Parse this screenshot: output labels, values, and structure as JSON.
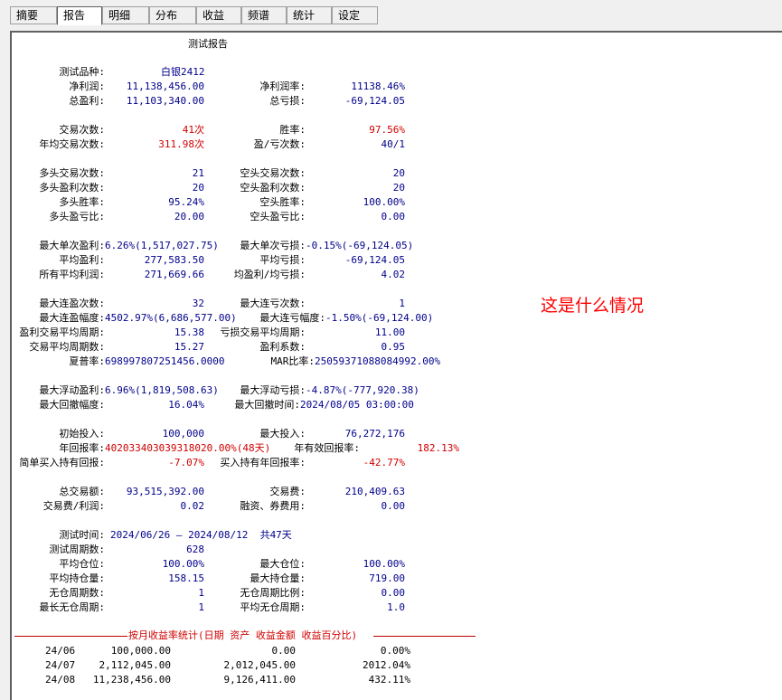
{
  "tabs": [
    {
      "label": "摘要"
    },
    {
      "label": "报告"
    },
    {
      "label": "明细"
    },
    {
      "label": "分布"
    },
    {
      "label": "收益"
    },
    {
      "label": "频谱"
    },
    {
      "label": "统计"
    },
    {
      "label": "设定"
    }
  ],
  "report": {
    "title": "测试报告",
    "product_label": "测试品种:",
    "product": "白银2412",
    "net_profit_label": "净利润:",
    "net_profit": "11,138,456.00",
    "net_profit_rate_label": "净利润率:",
    "net_profit_rate": "11138.46%",
    "gross_profit_label": "总盈利:",
    "gross_profit": "11,103,340.00",
    "gross_loss_label": "总亏损:",
    "gross_loss": "-69,124.05",
    "trades_label": "交易次数:",
    "trades": "41次",
    "win_rate_label": "胜率:",
    "win_rate": "97.56%",
    "annual_trades_label": "年均交易次数:",
    "annual_trades": "311.98次",
    "win_loss_count_label": "盈/亏次数:",
    "win_loss_count": "40/1",
    "long_trades_label": "多头交易次数:",
    "long_trades": "21",
    "short_trades_label": "空头交易次数:",
    "short_trades": "20",
    "long_wins_label": "多头盈利次数:",
    "long_wins": "20",
    "short_wins_label": "空头盈利次数:",
    "short_wins": "20",
    "long_win_rate_label": "多头胜率:",
    "long_win_rate": "95.24%",
    "short_win_rate_label": "空头胜率:",
    "short_win_rate": "100.00%",
    "long_pl_ratio_label": "多头盈亏比:",
    "long_pl_ratio": "20.00",
    "short_pl_ratio_label": "空头盈亏比:",
    "short_pl_ratio": "0.00",
    "max_single_win_label": "最大单次盈利:",
    "max_single_win": "6.26%(1,517,027.75)",
    "max_single_loss_label": "最大单次亏损:",
    "max_single_loss": "-0.15%(-69,124.05)",
    "avg_win_label": "平均盈利:",
    "avg_win": "277,583.50",
    "avg_loss_label": "平均亏损:",
    "avg_loss": "-69,124.05",
    "avg_profit_all_label": "所有平均利润:",
    "avg_profit_all": "271,669.66",
    "avg_win_loss_ratio_label": "均盈利/均亏损:",
    "avg_win_loss_ratio": "4.02",
    "max_consec_wins_label": "最大连盈次数:",
    "max_consec_wins": "32",
    "max_consec_losses_label": "最大连亏次数:",
    "max_consec_losses": "1",
    "max_consec_win_amp_label": "最大连盈幅度:",
    "max_consec_win_amp": "4502.97%(6,686,577.00)",
    "max_consec_loss_amp_label": "最大连亏幅度:",
    "max_consec_loss_amp": "-1.50%(-69,124.00)",
    "win_avg_period_label": "盈利交易平均周期:",
    "win_avg_period": "15.38",
    "loss_avg_period_label": "亏损交易平均周期:",
    "loss_avg_period": "11.00",
    "trade_avg_period_label": "交易平均周期数:",
    "trade_avg_period": "15.27",
    "profit_factor_label": "盈利系数:",
    "profit_factor": "0.95",
    "sharpe_label": "夏普率:",
    "sharpe": "698997807251456.0000",
    "mar_label": "MAR比率:",
    "mar": "25059371088084992.00%",
    "max_float_win_label": "最大浮动盈利:",
    "max_float_win": "6.96%(1,819,508.63)",
    "max_float_loss_label": "最大浮动亏损:",
    "max_float_loss": "-4.87%(-777,920.38)",
    "max_drawdown_label": "最大回撤幅度:",
    "max_drawdown": "16.04%",
    "max_drawdown_time_label": "最大回撤时间:",
    "max_drawdown_time": "2024/08/05 03:00:00",
    "initial_capital_label": "初始投入:",
    "initial_capital": "100,000",
    "max_capital_label": "最大投入:",
    "max_capital": "76,272,176",
    "annual_return_label": "年回报率:",
    "annual_return": "4020334030393180​20.00%(48天)",
    "annual_effective_return_label": "年有效回报率:",
    "annual_effective_return": "182.13%",
    "bh_return_label": "简单买入持有回报:",
    "bh_return": "-7.07%",
    "bh_annual_return_label": "买入持有年回报率:",
    "bh_annual_return": "-42.77%",
    "turnover_label": "总交易额:",
    "turnover": "93,515,392.00",
    "fee_label": "交易费:",
    "fee": "210,409.63",
    "fee_profit_ratio_label": "交易费/利润:",
    "fee_profit_ratio": "0.02",
    "financing_fee_label": "融资、券费用:",
    "financing_fee": "0.00",
    "test_time_label": "测试时间:",
    "test_time": "2024/06/26 — 2024/08/12  共47天",
    "test_periods_label": "测试周期数:",
    "test_periods": "628",
    "avg_position_label": "平均仓位:",
    "avg_position": "100.00%",
    "max_position_label": "最大仓位:",
    "max_position": "100.00%",
    "avg_holding_label": "平均持仓量:",
    "avg_holding": "158.15",
    "max_holding_label": "最大持仓量:",
    "max_holding": "719.00",
    "flat_periods_label": "无仓周期数:",
    "flat_periods": "1",
    "flat_ratio_label": "无仓周期比例:",
    "flat_ratio": "0.00",
    "longest_flat_label": "最长无仓周期:",
    "longest_flat": "1",
    "avg_flat_label": "平均无仓周期:",
    "avg_flat": "1.0",
    "monthly_header": "按月收益率统计(日期 资产 收益金额 收益百分比)",
    "monthly_rows": [
      {
        "date": "24/06",
        "assets": "100,000.00",
        "profit": "0.00",
        "pct": "0.00%"
      },
      {
        "date": "24/07",
        "assets": "2,112,045.00",
        "profit": "2,012,045.00",
        "pct": "2012.04%"
      },
      {
        "date": "24/08",
        "assets": "11,238,456.00",
        "profit": "9,126,411.00",
        "pct": "432.11%"
      }
    ]
  },
  "annotation": "这是什么情况",
  "colors": {
    "value": "#00008b",
    "highlight": "#d00000",
    "annotation": "#ff0000"
  }
}
